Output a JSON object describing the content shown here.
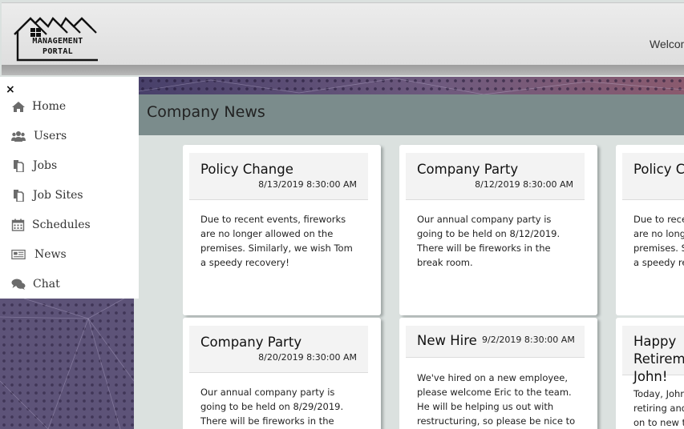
{
  "header": {
    "logo_line1": "MANAGEMENT",
    "logo_line2": "PORTAL",
    "welcome": "Welcome"
  },
  "sidebar": {
    "close": "×",
    "items": [
      {
        "label": "Home",
        "icon": "home-icon"
      },
      {
        "label": "Users",
        "icon": "users-icon"
      },
      {
        "label": "Jobs",
        "icon": "copy-icon"
      },
      {
        "label": "Job Sites",
        "icon": "copy-icon"
      },
      {
        "label": "Schedules",
        "icon": "calendar-icon"
      },
      {
        "label": "News",
        "icon": "newspaper-icon"
      },
      {
        "label": "Chat",
        "icon": "comments-icon"
      }
    ]
  },
  "main": {
    "title": "Company News",
    "cards": [
      {
        "title": "Policy Change",
        "date": "8/13/2019 8:30:00 AM",
        "body": "Due to recent events, fireworks are no longer allowed on the premises. Similarly, we wish Tom a speedy recovery!"
      },
      {
        "title": "Company Party",
        "date": "8/12/2019 8:30:00 AM",
        "body": "Our annual company party is going to be held on 8/12/2019. There will be fireworks in the break room."
      },
      {
        "title": "Policy Change",
        "date": "",
        "body": "Due to recent events, fireworks are no longer allowed on the premises. Similarly, we wish Tom a speedy recovery!"
      },
      {
        "title": "Company Party",
        "date": "8/20/2019 8:30:00 AM",
        "body": "Our annual company party is going to be held on 8/29/2019. There will be fireworks in the break room."
      },
      {
        "title": "New Hire",
        "date": "9/2/2019 8:30:00 AM",
        "body": "We've hired on a new employee, please welcome Eric to the team. He will be helping us out with restructuring, so please be nice to him."
      },
      {
        "title": "Happy Retirement, John!",
        "date": "",
        "body": "Today, John is retiring and moving on to new things. Way to go, John!"
      }
    ]
  },
  "colors": {
    "news_bar": "#7b8c8c",
    "content_bg": "#dbe1df",
    "texture": "#5d5378"
  }
}
